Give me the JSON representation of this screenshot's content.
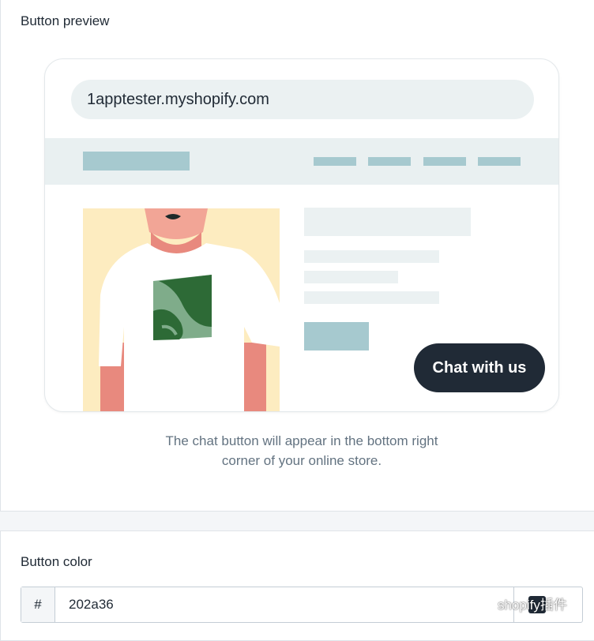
{
  "preview": {
    "title": "Button preview",
    "url": "1apptester.myshopify.com",
    "chat_button_label": "Chat with us",
    "caption_line1": "The chat button will appear in the bottom right",
    "caption_line2": "corner of your online store."
  },
  "color": {
    "title": "Button color",
    "prefix": "#",
    "value": "202a36",
    "swatch_hex": "#202a36"
  },
  "colors": {
    "placeholder_block": "#a6c9cf",
    "placeholder_light": "#ebf1f2",
    "chat_button_bg": "#202a36",
    "shirt_graphic": "#2d6a36"
  },
  "watermark": {
    "text": "shopify插件",
    "icon": "wechat-icon"
  }
}
